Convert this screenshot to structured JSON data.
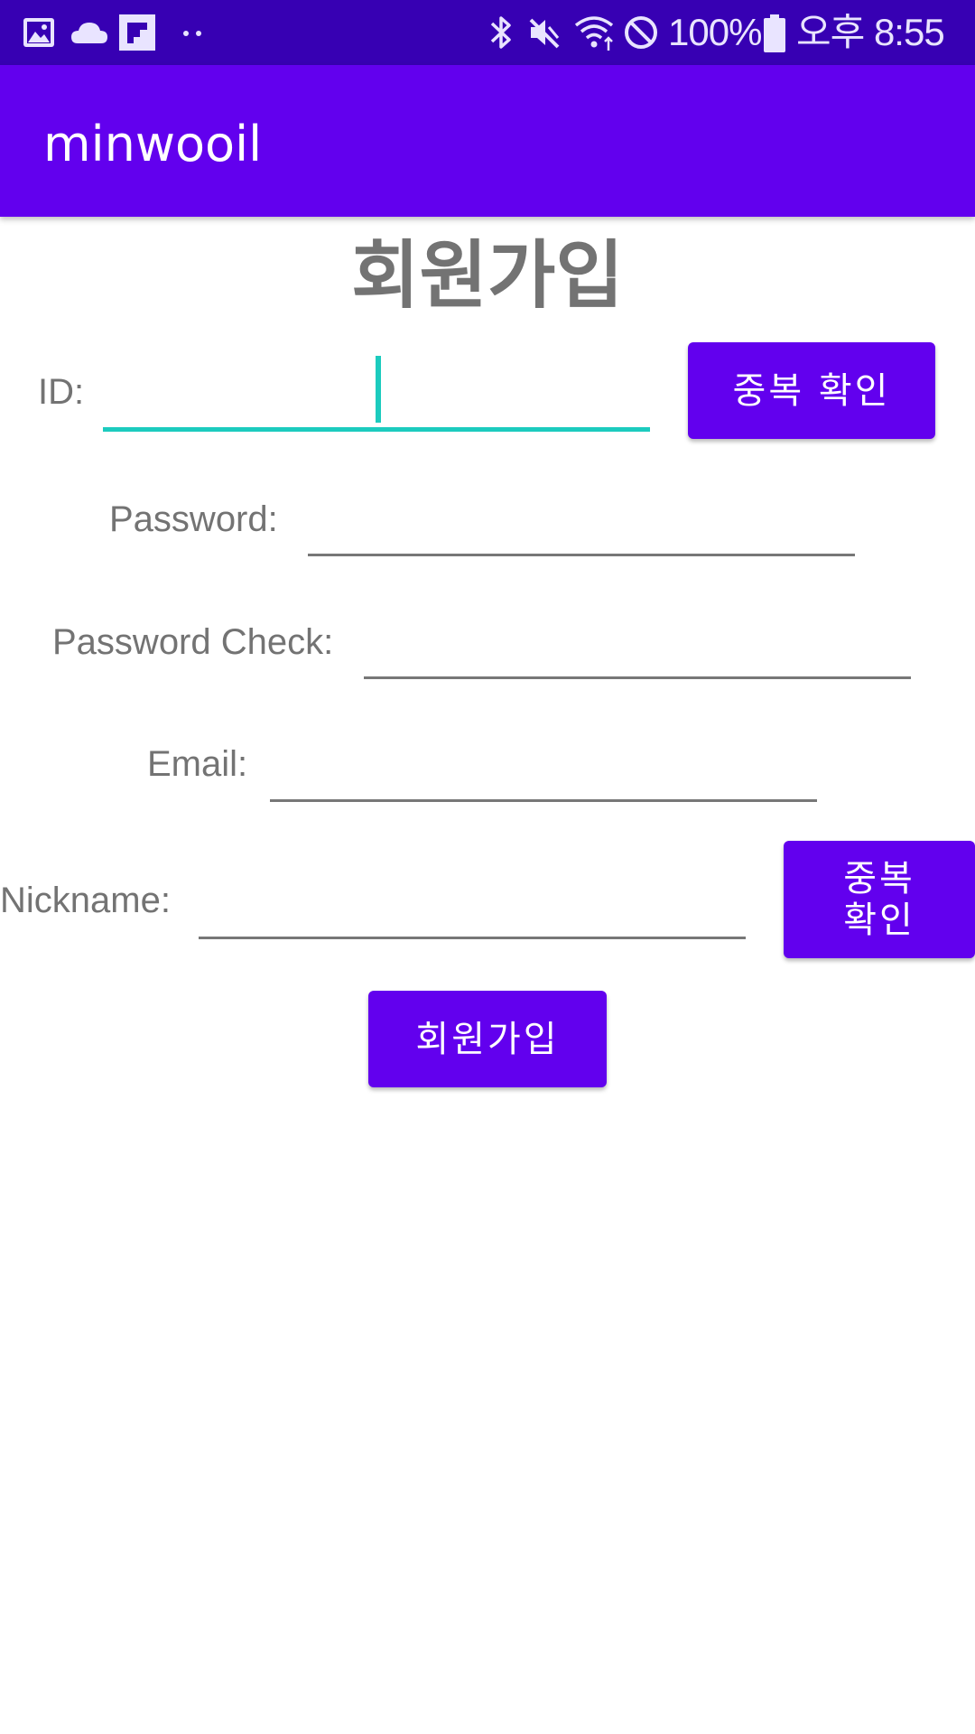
{
  "status_bar": {
    "left_icons": [
      "gallery-icon",
      "cloud-icon",
      "flipboard-icon",
      "more-dots-icon"
    ],
    "right_icons": [
      "bluetooth-icon",
      "mute-icon",
      "wifi-icon",
      "do-not-disturb-icon",
      "battery-icon"
    ],
    "battery": "100%",
    "time": "오후 8:55"
  },
  "app_bar": {
    "title": "minwooil"
  },
  "page": {
    "title": "회원가입"
  },
  "form": {
    "id": {
      "label": "ID:",
      "value": ""
    },
    "password": {
      "label": "Password:",
      "value": ""
    },
    "password_check": {
      "label": "Password Check:",
      "value": ""
    },
    "email": {
      "label": "Email:",
      "value": ""
    },
    "nickname": {
      "label": "Nickname:",
      "value": ""
    }
  },
  "buttons": {
    "id_duplicate_check": "중복 확인",
    "nickname_duplicate_check": "중복\n확인",
    "signup": "회원가입"
  },
  "colors": {
    "status_bar": "#3700b3",
    "primary": "#6200ee",
    "focus_accent": "#1ccbbe",
    "label_text": "#737373"
  }
}
